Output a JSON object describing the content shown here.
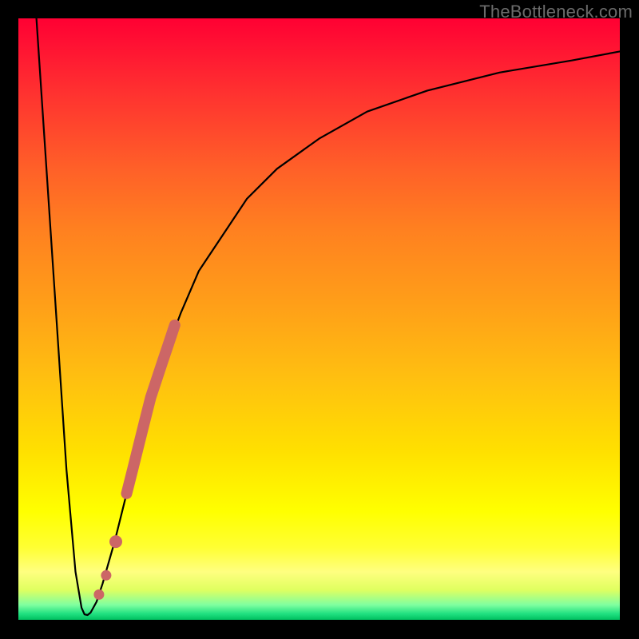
{
  "watermark": "TheBottleneck.com",
  "chart_data": {
    "type": "line",
    "title": "",
    "xlabel": "",
    "ylabel": "",
    "xlim": [
      0,
      100
    ],
    "ylim": [
      0,
      100
    ],
    "grid": false,
    "legend": false,
    "series": [
      {
        "name": "bottleneck-curve",
        "color": "#000000",
        "x": [
          3,
          6,
          8,
          9.5,
          10.5,
          11,
          11.5,
          12,
          13,
          14,
          16,
          18,
          20,
          22,
          24,
          27,
          30,
          34,
          38,
          43,
          50,
          58,
          68,
          80,
          92,
          100
        ],
        "y": [
          100,
          55,
          25,
          8,
          2,
          0.9,
          0.8,
          1.2,
          3,
          6,
          13,
          21,
          29,
          36,
          43,
          51,
          58,
          64,
          70,
          75,
          80,
          84.5,
          88,
          91,
          93,
          94.5
        ]
      },
      {
        "name": "highlight-segment",
        "color": "#cc6666",
        "thick": true,
        "x": [
          18,
          19,
          20,
          21,
          22,
          23,
          24,
          25,
          26
        ],
        "y": [
          21,
          25,
          29,
          33,
          37,
          40,
          43,
          46,
          49
        ]
      }
    ],
    "highlight_points": {
      "color": "#cc6666",
      "points": [
        {
          "x": 13.4,
          "y": 4.2
        },
        {
          "x": 14.6,
          "y": 7.4
        },
        {
          "x": 16.2,
          "y": 13.0
        }
      ]
    }
  }
}
